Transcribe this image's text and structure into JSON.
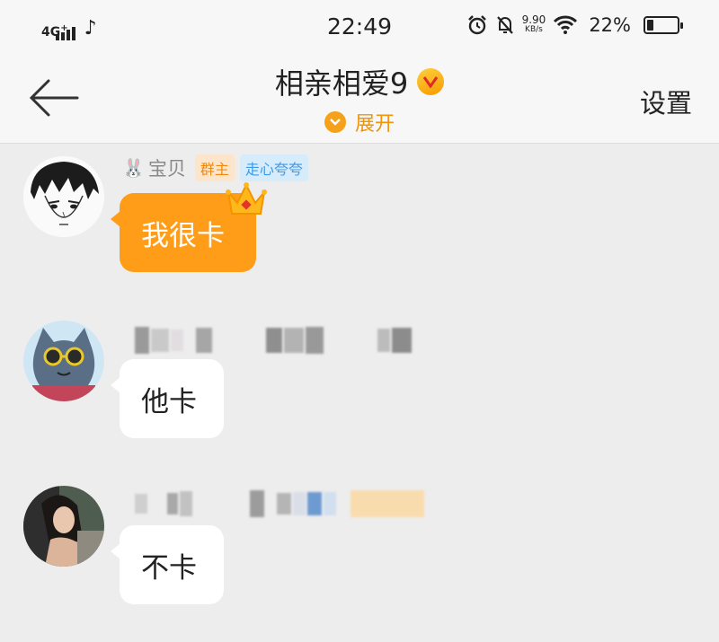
{
  "status_bar": {
    "network": "4G",
    "network_sup": "+",
    "time": "22:49",
    "speed_value": "9.90",
    "speed_unit": "KB/s",
    "battery_percent": "22%",
    "battery_level": 0.22
  },
  "header": {
    "group_name": "相亲相爱9",
    "expand_label": "展开",
    "settings_label": "设置"
  },
  "messages": [
    {
      "sender": "宝贝",
      "sender_emoji": "🐰",
      "role_tag": "群主",
      "title_tag": "走心夸夸",
      "text": "我很卡",
      "bubble_color": "#ff9d18"
    },
    {
      "sender": "",
      "text": "他卡",
      "bubble_color": "#ffffff"
    },
    {
      "sender": "",
      "text": "不卡",
      "bubble_color": "#ffffff"
    }
  ],
  "colors": {
    "accent": "#f5a21a",
    "owner_tag_bg": "#fde5cc",
    "owner_tag_text": "#f08a0b",
    "title_tag_bg": "#d7ecfb",
    "title_tag_text": "#3c9be8",
    "background": "#ededed"
  }
}
